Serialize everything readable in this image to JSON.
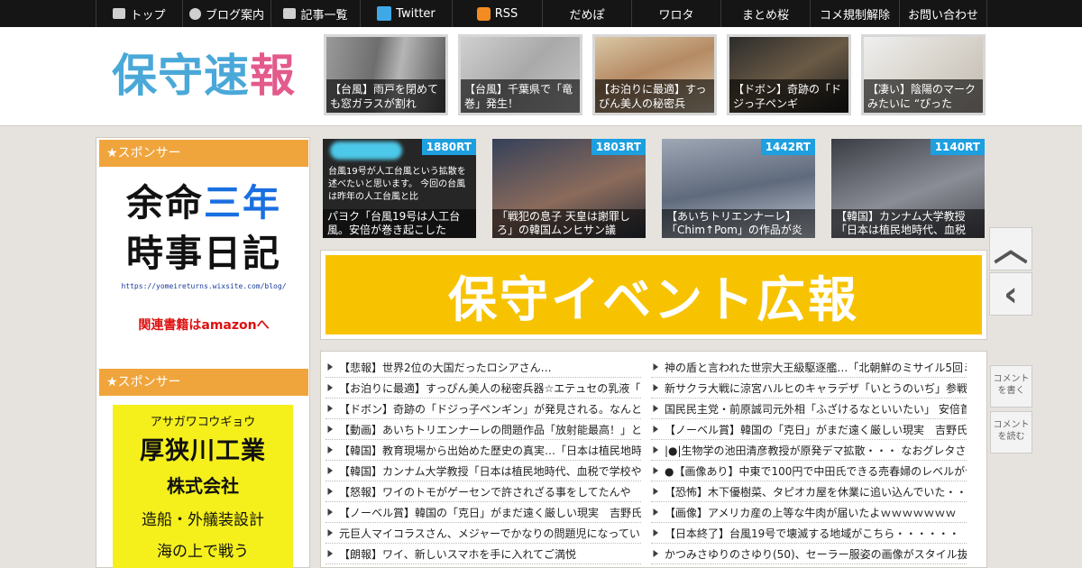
{
  "nav": {
    "items": [
      {
        "label": "トップ",
        "icon": "home-icon"
      },
      {
        "label": "ブログ案内",
        "icon": "info-icon"
      },
      {
        "label": "記事一覧",
        "icon": "list-icon"
      },
      {
        "label": "Twitter",
        "icon": "twitter-icon"
      },
      {
        "label": "RSS",
        "icon": "rss-icon"
      },
      {
        "label": "だめぽ"
      },
      {
        "label": "ワロタ"
      },
      {
        "label": "まとめ桜"
      },
      {
        "label": "コメ規制解除"
      },
      {
        "label": "お問い合わせ"
      }
    ]
  },
  "header": {
    "logo_part1": "保守",
    "logo_part2": "速",
    "logo_part3": "報",
    "thumbs": [
      {
        "caption": "【台風】雨戸を閉めても窓ガラスが割れ"
      },
      {
        "caption": "【台風】千葉県で「竜巻」発生！"
      },
      {
        "caption": "【お泊りに最適】すっぴん美人の秘密兵"
      },
      {
        "caption": "【ドボン】奇跡の「ドジっ子ペンギ"
      },
      {
        "caption": "【凄い】陰陽のマークみたいに “ぴった"
      }
    ]
  },
  "sidebar": {
    "sponsor1": "★スポンサー",
    "ad1": {
      "line1_a": "余命",
      "line1_b": "三年",
      "line2": "時事日記",
      "url": "https://yomeireturns.wixsite.com/blog/",
      "amazon": "関連書籍はamazonへ"
    },
    "sponsor2": "★スポンサー",
    "ad2": {
      "kana": "アサガワコウギョウ",
      "name": "厚狭川工業",
      "corp": "株式会社",
      "service": "造船・外艤装設計",
      "more": "海の上で戦う"
    }
  },
  "ranking": [
    {
      "badge": "1880RT",
      "caption": "パヨク「台風19号は人工台風。安倍が巻き起こした",
      "inner": "台風19号が人工台風という拡散を述べたいと思います。 今回の台風は昨年の人工台風と比"
    },
    {
      "badge": "1803RT",
      "caption": "「戦犯の息子 天皇は謝罪しろ」の韓国ムンヒサン議"
    },
    {
      "badge": "1442RT",
      "caption": "【あいちトリエンナーレ】「Chim↑Pom」の作品が炎"
    },
    {
      "badge": "1140RT",
      "caption": "【韓国】カンナム大学教授「日本は植民地時代、血税"
    }
  ],
  "banner": {
    "text": "保守イベント広報"
  },
  "articles_left": [
    "【悲報】世界2位の大国だったロシアさん…",
    "【お泊りに最適】すっぴん美人の秘密兵器☆エテュセの乳液「",
    "【ドボン】奇跡の「ドジっ子ペンギン」が発見される。なんと",
    "【動画】あいちトリエンナーレの問題作品「放射能最高！」と",
    "【韓国】教育現場から出始めた歴史の真実…「日本は植民地時",
    "【韓国】カンナム大学教授「日本は植民地時代、血税で学校や",
    "【怒報】ワイのトモがゲーセンで許されざる事をしてたんや",
    "【ノーベル賞】韓国の「克日」がまだ遠く厳しい現実　吉野氏",
    "元巨人マイコラスさん、メジャーでかなりの問題児になってい",
    "【朗報】ワイ、新しいスマホを手に入れてご満悦"
  ],
  "articles_right": [
    "神の盾と言われた世宗大王級駆逐艦…「北朝鮮のミサイル5回ミ",
    "新サクラ大戦に涼宮ハルヒのキャラデザ「いとうのいぢ」参戦",
    "国民民主党・前原誠司元外相「ふざけるなといいたい」 安倍首",
    "【ノーベル賞】韓国の「克日」がまだ遠く厳しい現実　吉野氏",
    "|●|生物学の池田清彦教授が原発デマ拡散・・・ なおグレタさん",
    "●【画像あり】中東で100円で中田氏できる売春婦のレベルがヤ",
    "【恐怖】木下優樹菜、タピオカ屋を休業に追い込んでいた・・",
    "【画像】アメリカ産の上等な牛肉が届いたよｗｗｗｗｗｗｗ",
    "【日本終了】台風19号で壊滅する地域がこちら・・・・・・",
    "かつみさゆりのさゆり(50)、セーラー服姿の画像がスタイル抜群"
  ],
  "sidebuttons": {
    "comment_write": "コメントを書く",
    "comment_read": "コメントを読む"
  }
}
